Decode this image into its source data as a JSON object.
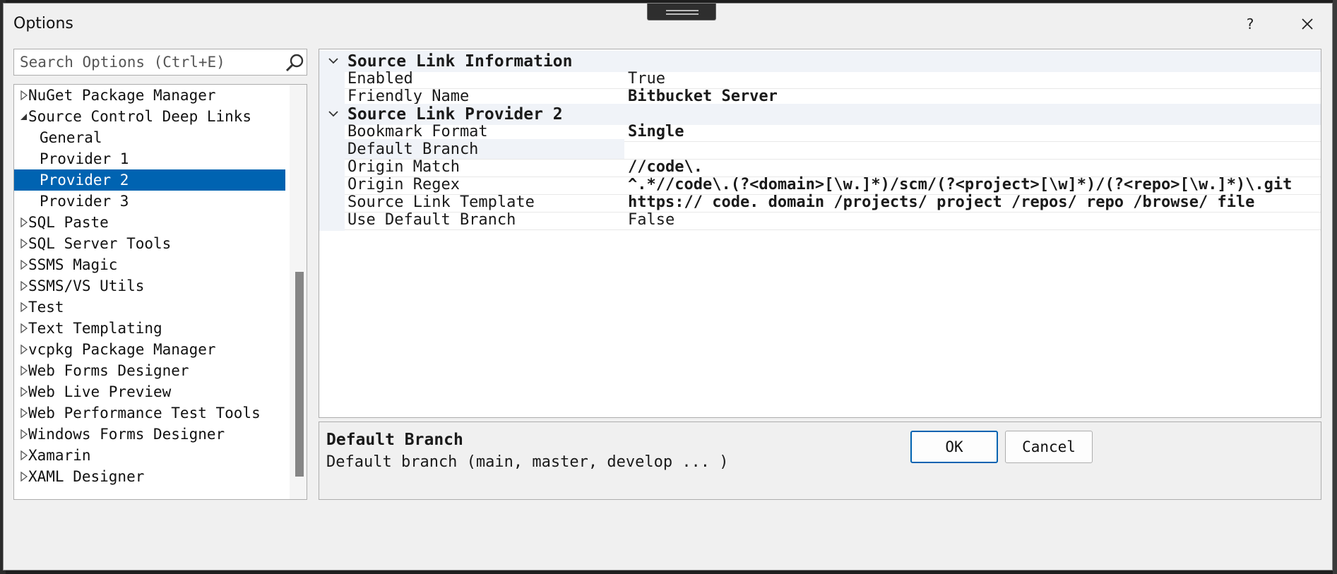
{
  "window": {
    "title": "Options",
    "help_label": "?"
  },
  "search": {
    "placeholder": "Search Options (Ctrl+E)"
  },
  "tree": {
    "items": [
      {
        "label": "NuGet Package Manager",
        "state": "collapsed"
      },
      {
        "label": "Source Control Deep Links",
        "state": "expanded"
      },
      {
        "label": "General",
        "state": "leaf"
      },
      {
        "label": "Provider 1",
        "state": "leaf"
      },
      {
        "label": "Provider 2",
        "state": "leaf",
        "selected": true
      },
      {
        "label": "Provider 3",
        "state": "leaf"
      },
      {
        "label": "SQL Paste",
        "state": "collapsed"
      },
      {
        "label": "SQL Server Tools",
        "state": "collapsed"
      },
      {
        "label": "SSMS Magic",
        "state": "collapsed"
      },
      {
        "label": "SSMS/VS Utils",
        "state": "collapsed"
      },
      {
        "label": "Test",
        "state": "collapsed"
      },
      {
        "label": "Text Templating",
        "state": "collapsed"
      },
      {
        "label": "vcpkg Package Manager",
        "state": "collapsed"
      },
      {
        "label": "Web Forms Designer",
        "state": "collapsed"
      },
      {
        "label": "Web Live Preview",
        "state": "collapsed"
      },
      {
        "label": "Web Performance Test Tools",
        "state": "collapsed"
      },
      {
        "label": "Windows Forms Designer",
        "state": "collapsed"
      },
      {
        "label": "Xamarin",
        "state": "collapsed"
      },
      {
        "label": "XAML Designer",
        "state": "collapsed"
      }
    ]
  },
  "grid": {
    "categories": [
      {
        "label": "Source Link Information",
        "properties": [
          {
            "name": "Enabled",
            "value": "True"
          },
          {
            "name": "Friendly Name",
            "value": "Bitbucket Server",
            "bold": true
          }
        ]
      },
      {
        "label": "Source Link Provider 2",
        "properties": [
          {
            "name": "Bookmark Format",
            "value": "Single",
            "bold": true
          },
          {
            "name": "Default Branch",
            "value": "",
            "selected": true
          },
          {
            "name": "Origin Match",
            "value": "//code\\.",
            "bold": true
          },
          {
            "name": "Origin Regex",
            "value": "^.*//code\\.(?<domain>[\\w.]*)/scm/(?<project>[\\w]*)/(?<repo>[\\w.]*)\\.git",
            "bold": true
          },
          {
            "name": "Source Link Template",
            "value": "https:// code. domain /projects/ project /repos/ repo /browse/ file",
            "bold": true
          },
          {
            "name": "Use Default Branch",
            "value": "False"
          }
        ]
      }
    ]
  },
  "description": {
    "title": "Default Branch",
    "text": "Default branch (main, master, develop ... )"
  },
  "buttons": {
    "ok": "OK",
    "cancel": "Cancel"
  },
  "colors": {
    "selection": "#0063b1",
    "category_background": "#f0f3f8",
    "dialog_background": "#f0f0f0"
  }
}
